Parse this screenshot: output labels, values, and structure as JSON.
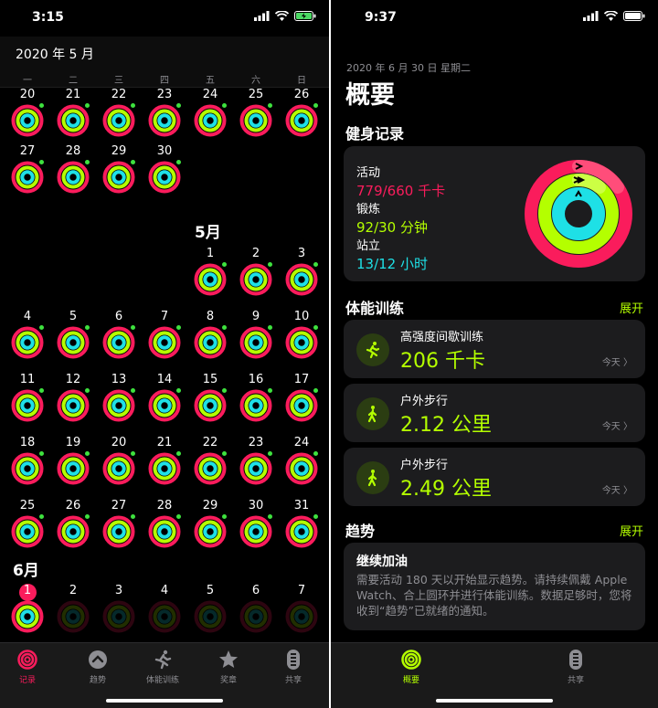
{
  "left": {
    "status_time": "3:15",
    "calendar_title": "2020 年 5 月",
    "weekdays": [
      "一",
      "二",
      "三",
      "四",
      "五",
      "六",
      "日"
    ],
    "april_tail_days": [
      "20",
      "21",
      "22",
      "23",
      "24",
      "25",
      "26",
      "27",
      "28",
      "29",
      "30"
    ],
    "may_label": "5月",
    "may_days": [
      "1",
      "2",
      "3",
      "4",
      "5",
      "6",
      "7",
      "8",
      "9",
      "10",
      "11",
      "12",
      "13",
      "14",
      "15",
      "16",
      "17",
      "18",
      "19",
      "20",
      "21",
      "22",
      "23",
      "24",
      "25",
      "26",
      "27",
      "28",
      "29",
      "30",
      "31"
    ],
    "june_label": "6月",
    "june_days": [
      "1",
      "2",
      "3",
      "4",
      "5",
      "6",
      "7"
    ],
    "tabs": [
      {
        "label": "记录",
        "icon": "rings-icon",
        "active": true
      },
      {
        "label": "趋势",
        "icon": "trend-arrow-icon",
        "active": false
      },
      {
        "label": "体能训练",
        "icon": "runner-icon",
        "active": false
      },
      {
        "label": "奖章",
        "icon": "award-star-icon",
        "active": false
      },
      {
        "label": "共享",
        "icon": "sharing-icon",
        "active": false
      }
    ]
  },
  "right": {
    "status_time": "9:37",
    "date_line": "2020 年 6 月 30 日 星期二",
    "title": "概要",
    "fitness_section": "健身记录",
    "activity": [
      {
        "label": "活动",
        "value": "779/660 千卡",
        "color": "#fa1c5c"
      },
      {
        "label": "锻炼",
        "value": "92/30 分钟",
        "color": "#b4ff00"
      },
      {
        "label": "站立",
        "value": "13/12 小时",
        "color": "#1ee0e6"
      }
    ],
    "workouts_section": "体能训练",
    "workouts_link": "展开",
    "workouts": [
      {
        "name": "高强度间歇训练",
        "value": "206 千卡",
        "date": "今天 〉",
        "icon": "hiit-runner-icon"
      },
      {
        "name": "户外步行",
        "value": "2.12 公里",
        "date": "今天 〉",
        "icon": "walking-icon"
      },
      {
        "name": "户外步行",
        "value": "2.49 公里",
        "date": "今天 〉",
        "icon": "walking-icon"
      }
    ],
    "trends_section": "趋势",
    "trends_link": "展开",
    "trend_card_title": "继续加油",
    "trend_card_text": "需要活动 180 天以开始显示趋势。请持续佩戴 Apple Watch、合上圆环并进行体能训练。数据足够时，您将收到“趋势”已就绪的通知。",
    "tabs": [
      {
        "label": "概要",
        "icon": "rings-icon",
        "active": true
      },
      {
        "label": "共享",
        "icon": "sharing-icon",
        "active": false
      }
    ]
  },
  "colors": {
    "move": "#fa1c5c",
    "exercise": "#b4ff00",
    "stand": "#1ee0e6",
    "accent_green": "#b4ff00"
  }
}
